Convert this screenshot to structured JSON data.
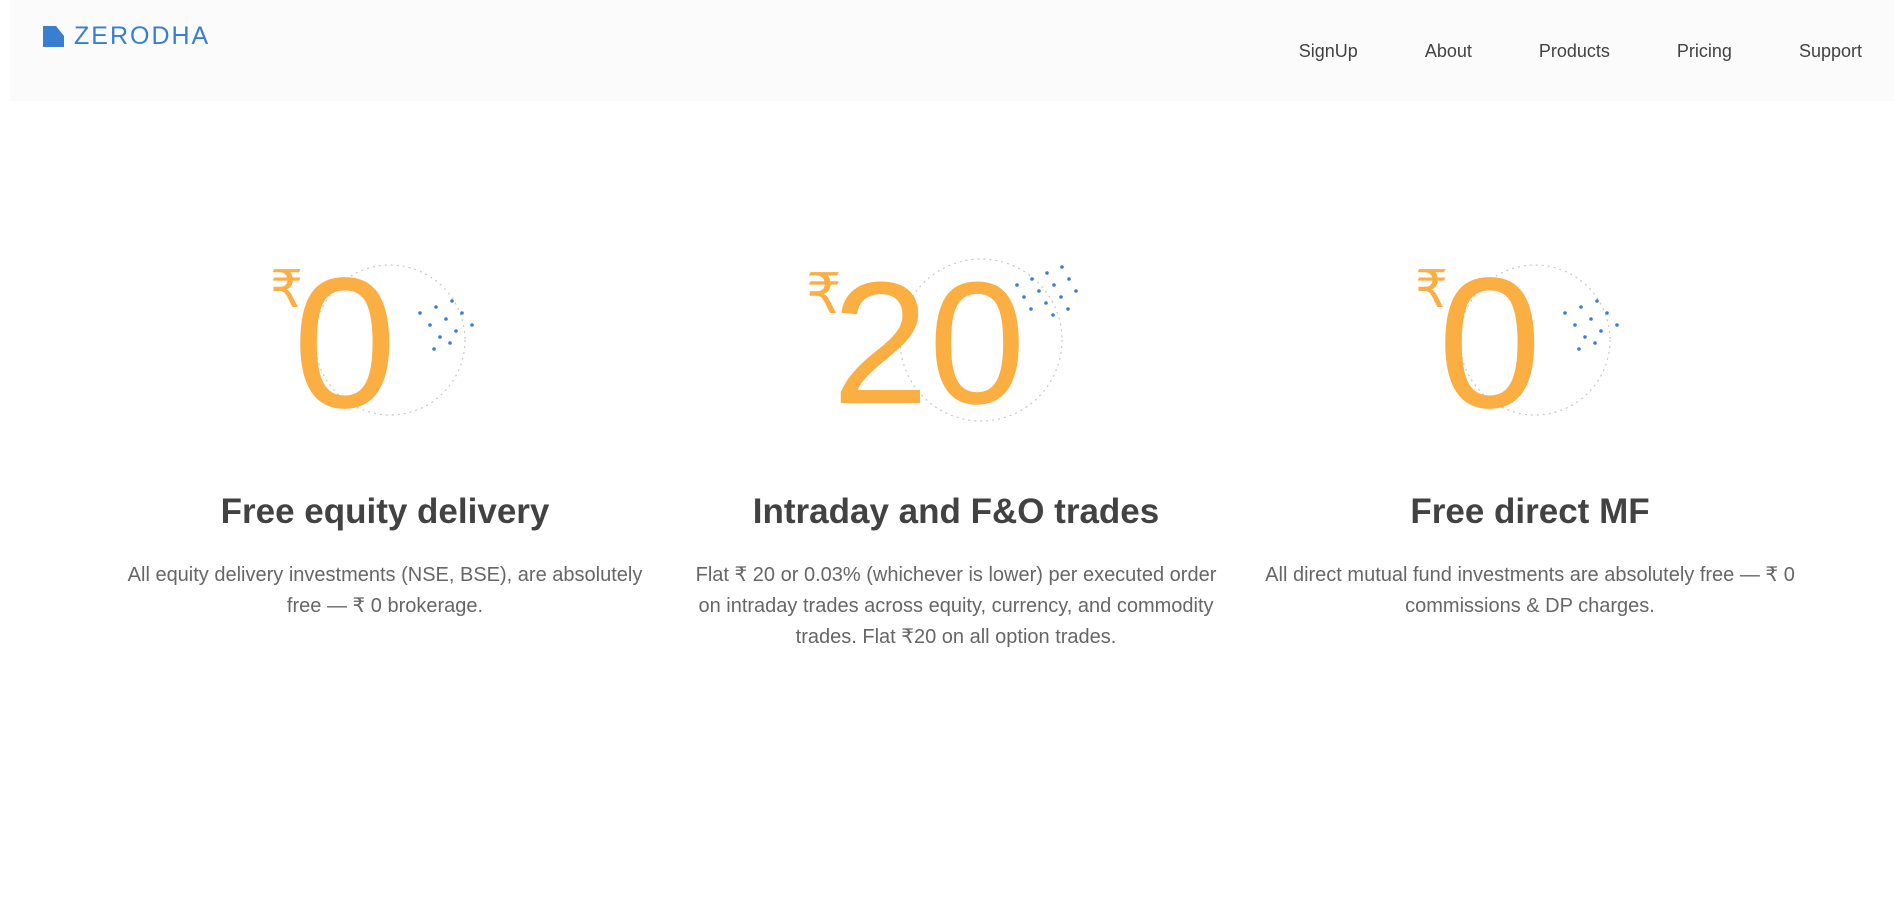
{
  "brand": {
    "name": "ZERODHA",
    "accent": "#387ed1"
  },
  "nav": {
    "links": [
      "SignUp",
      "About",
      "Products",
      "Pricing",
      "Support"
    ]
  },
  "colors": {
    "highlight": "#fbae42",
    "heading": "#424242",
    "text": "#666666"
  },
  "features": [
    {
      "currency": "₹",
      "amount": "0",
      "title": "Free equity delivery",
      "description_lines": [
        "All equity delivery investments (NSE, BSE), are absolutely",
        "free — ₹ 0 brokerage."
      ]
    },
    {
      "currency": "₹",
      "amount": "20",
      "title": "Intraday and F&O trades",
      "description_lines": [
        "Flat ₹ 20 or 0.03% (whichever is lower) per executed order",
        "on intraday trades across equity, currency, and commodity",
        "trades. Flat ₹20 on all option trades."
      ]
    },
    {
      "currency": "₹",
      "amount": "0",
      "title": "Free direct MF",
      "description_lines": [
        "All direct mutual fund investments are absolutely free — ₹ 0",
        "commissions & DP charges."
      ]
    }
  ]
}
